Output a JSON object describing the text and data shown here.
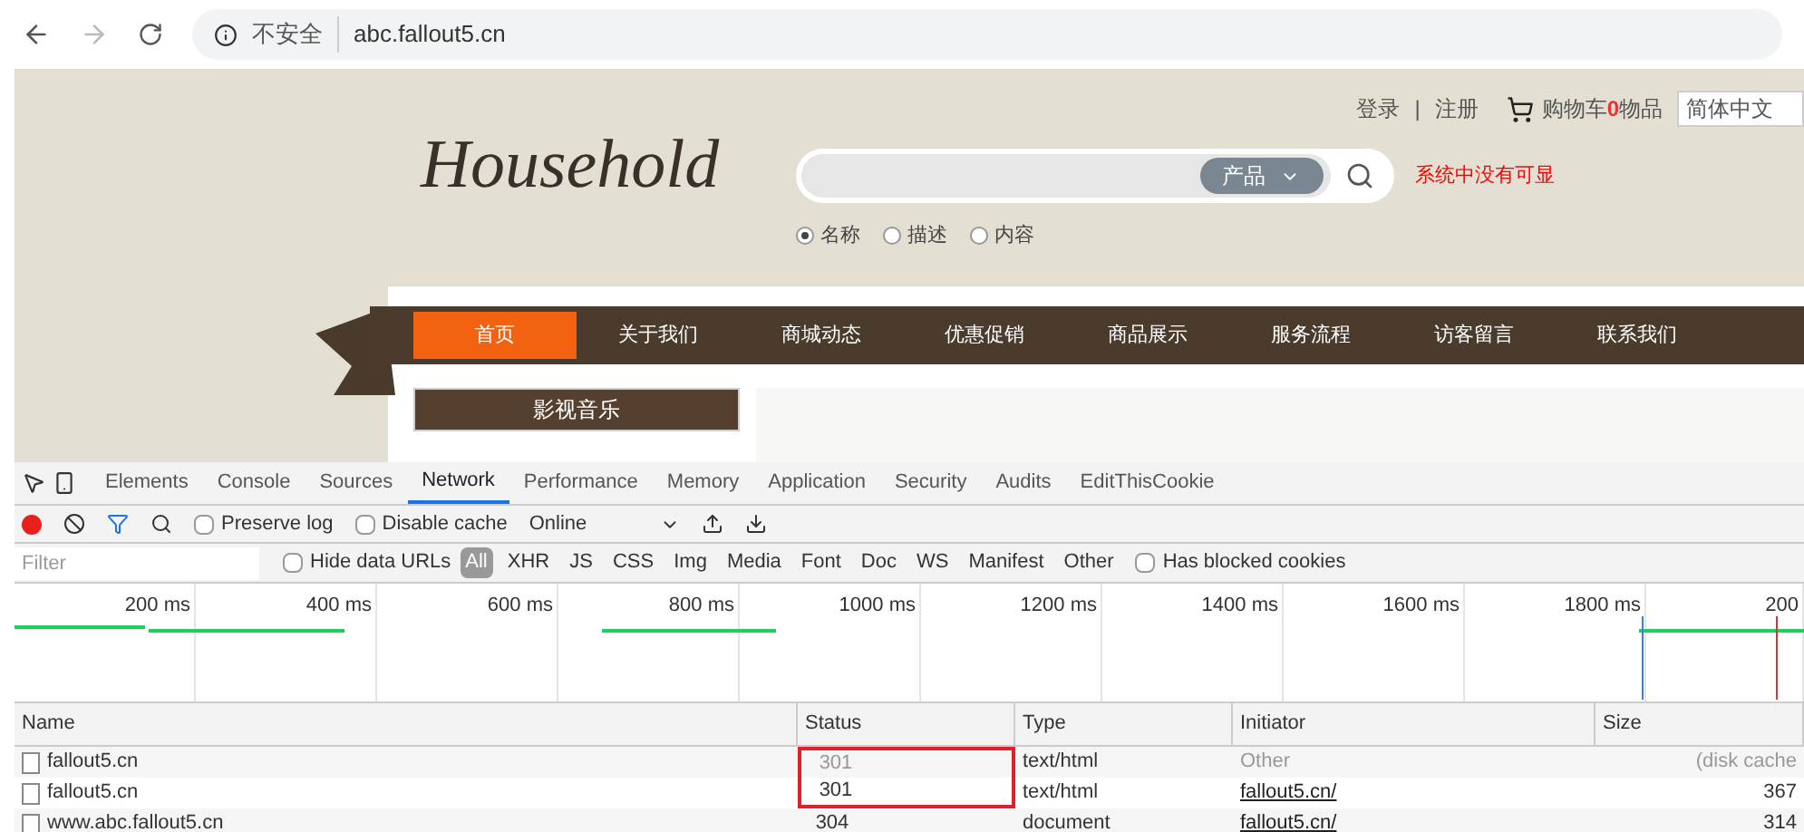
{
  "browser": {
    "url_warning": "不安全",
    "url": "abc.fallout5.cn"
  },
  "site": {
    "logo": "Household",
    "login": "登录",
    "separator": "|",
    "register": "注册",
    "cart_label": "购物车",
    "cart_count": "0",
    "cart_unit": "物品",
    "language": "简体中文",
    "search_category": "产品",
    "notice": "系统中没有可显",
    "search_options": [
      {
        "label": "名称",
        "selected": true
      },
      {
        "label": "描述",
        "selected": false
      },
      {
        "label": "内容",
        "selected": false
      }
    ],
    "nav": [
      {
        "label": "首页",
        "selected": true
      },
      {
        "label": "关于我们",
        "selected": false
      },
      {
        "label": "商城动态",
        "selected": false
      },
      {
        "label": "优惠促销",
        "selected": false
      },
      {
        "label": "商品展示",
        "selected": false
      },
      {
        "label": "服务流程",
        "selected": false
      },
      {
        "label": "访客留言",
        "selected": false
      },
      {
        "label": "联系我们",
        "selected": false
      }
    ],
    "category_button": "影视音乐"
  },
  "devtools": {
    "tabs": [
      {
        "label": "Elements",
        "selected": false
      },
      {
        "label": "Console",
        "selected": false
      },
      {
        "label": "Sources",
        "selected": false
      },
      {
        "label": "Network",
        "selected": true
      },
      {
        "label": "Performance",
        "selected": false
      },
      {
        "label": "Memory",
        "selected": false
      },
      {
        "label": "Application",
        "selected": false
      },
      {
        "label": "Security",
        "selected": false
      },
      {
        "label": "Audits",
        "selected": false
      },
      {
        "label": "EditThisCookie",
        "selected": false
      }
    ],
    "recording": true,
    "preserve_log": {
      "label": "Preserve log",
      "checked": false
    },
    "disable_cache": {
      "label": "Disable cache",
      "checked": false
    },
    "throttling": "Online",
    "filter_placeholder": "Filter",
    "hide_data_urls": {
      "label": "Hide data URLs",
      "checked": false
    },
    "types": [
      {
        "label": "All",
        "selected": true
      },
      {
        "label": "XHR",
        "selected": false
      },
      {
        "label": "JS",
        "selected": false
      },
      {
        "label": "CSS",
        "selected": false
      },
      {
        "label": "Img",
        "selected": false
      },
      {
        "label": "Media",
        "selected": false
      },
      {
        "label": "Font",
        "selected": false
      },
      {
        "label": "Doc",
        "selected": false
      },
      {
        "label": "WS",
        "selected": false
      },
      {
        "label": "Manifest",
        "selected": false
      },
      {
        "label": "Other",
        "selected": false
      }
    ],
    "blocked_cookies": {
      "label": "Has blocked cookies",
      "checked": false
    },
    "ticks": [
      "200 ms",
      "400 ms",
      "600 ms",
      "800 ms",
      "1000 ms",
      "1200 ms",
      "1400 ms",
      "1600 ms",
      "1800 ms",
      "200"
    ],
    "columns": [
      "Name",
      "Status",
      "Type",
      "Initiator",
      "Size"
    ],
    "rows": [
      {
        "name": "fallout5.cn",
        "status": "301",
        "type": "text/html",
        "initiator": "Other",
        "initiator_link": false,
        "size": "(disk cache",
        "cached": true,
        "highlighted": true
      },
      {
        "name": "fallout5.cn",
        "status": "301",
        "type": "text/html",
        "initiator": "fallout5.cn/",
        "initiator_link": true,
        "size": "367",
        "cached": false,
        "highlighted": true
      },
      {
        "name": "www.abc.fallout5.cn",
        "status": "304",
        "type": "document",
        "initiator": "fallout5.cn/",
        "initiator_link": true,
        "size": "314",
        "cached": false,
        "highlighted": false
      }
    ]
  }
}
